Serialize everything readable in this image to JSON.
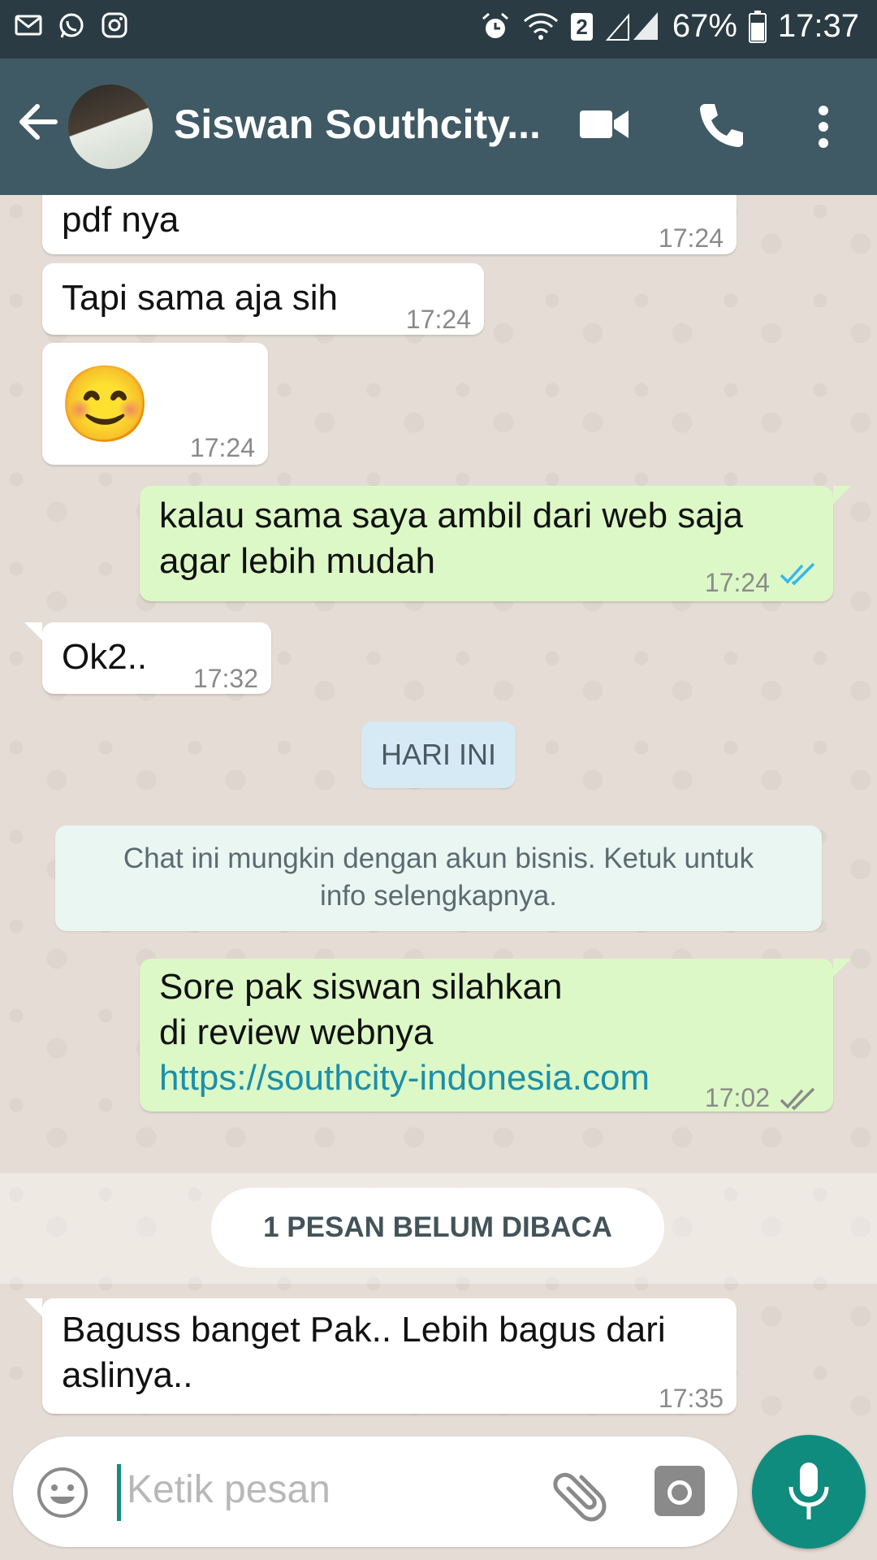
{
  "status_bar": {
    "battery": "67%",
    "time": "17:37",
    "sim_badge": "2",
    "left_icons": [
      "gmail-icon",
      "whatsapp-icon",
      "instagram-icon"
    ],
    "right_icons": [
      "alarm-icon",
      "wifi-icon",
      "signal-icon",
      "battery-icon"
    ]
  },
  "header": {
    "contact_name": "Siswan Southcity...",
    "icons": [
      "back-arrow-icon",
      "video-call-icon",
      "phone-icon",
      "more-vert-icon"
    ]
  },
  "messages": [
    {
      "direction": "incoming",
      "text": "pdf nya",
      "time": "17:24"
    },
    {
      "direction": "incoming",
      "text": "Tapi sama aja sih",
      "time": "17:24"
    },
    {
      "direction": "incoming",
      "text": "😊",
      "time": "17:24"
    },
    {
      "direction": "outgoing",
      "line1": "kalau sama saya ambil dari web saja",
      "line2": "agar lebih mudah",
      "time": "17:24",
      "read": true
    },
    {
      "direction": "incoming",
      "text": "Ok2..",
      "time": "17:32"
    }
  ],
  "date_chip": "HARI INI",
  "business_notice": {
    "line1": "Chat ini mungkin dengan akun bisnis. Ketuk untuk",
    "line2": "info selengkapnya."
  },
  "outgoing_today": {
    "line1": "Sore pak siswan silahkan",
    "line2": "di review webnya",
    "link": "https://southcity-indonesia.com",
    "time": "17:02",
    "read": false
  },
  "unread_label": "1 PESAN BELUM DIBACA",
  "last_message": {
    "line1": "Baguss banget Pak.. Lebih bagus dari",
    "line2": "aslinya..",
    "time": "17:35"
  },
  "input": {
    "placeholder": "Ketik pesan"
  },
  "colors": {
    "app_bar": "#3f5a65",
    "status_bar": "#2a3b43",
    "outgoing_bubble": "#dcf8c6",
    "incoming_bubble": "#ffffff",
    "accent": "#0f8c7e",
    "read_ticks": "#34b7f1",
    "link": "#1c8fa8"
  }
}
